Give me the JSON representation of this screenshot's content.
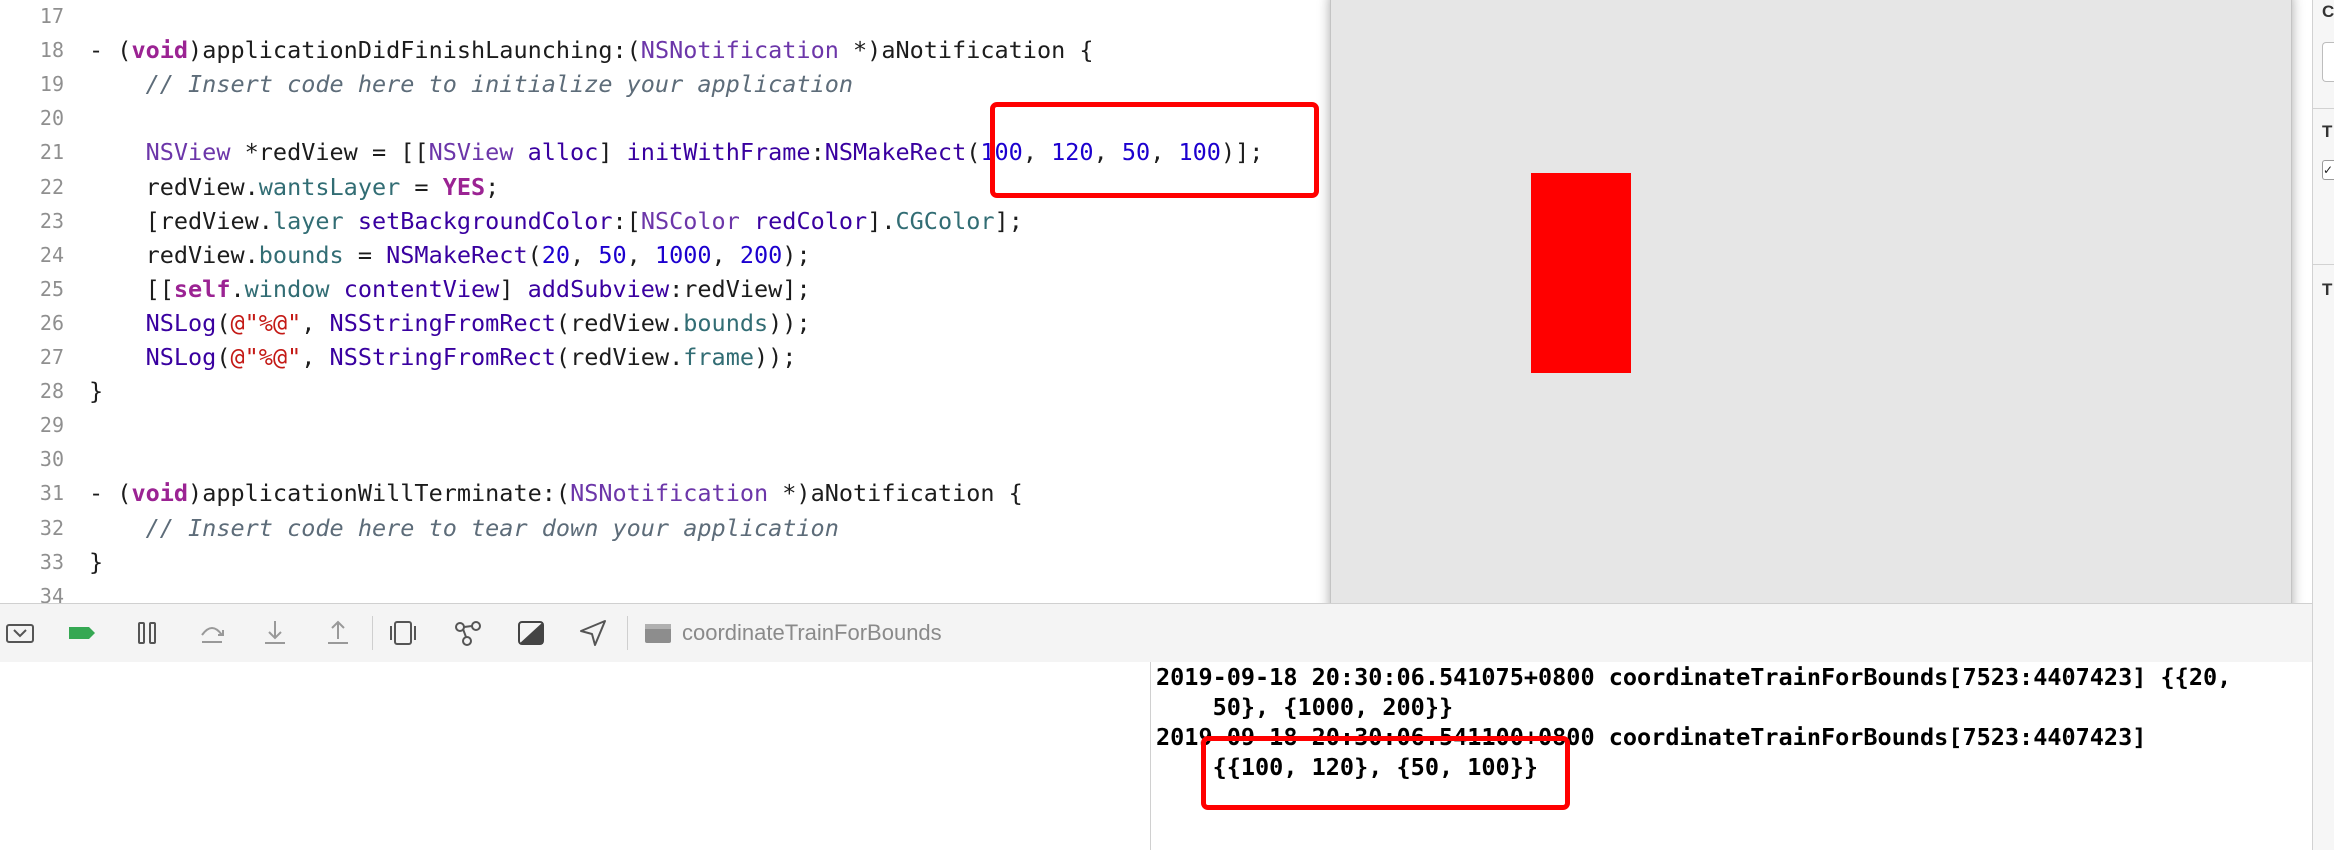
{
  "editor": {
    "lines": [
      {
        "num": "17",
        "tokens": []
      },
      {
        "num": "18",
        "tokens": [
          [
            "p",
            "- ("
          ],
          [
            "kw",
            "void"
          ],
          [
            "p",
            ")applicationDidFinishLaunching:("
          ],
          [
            "ty",
            "NSNotification"
          ],
          [
            "p",
            " *)aNotification {"
          ]
        ]
      },
      {
        "num": "19",
        "tokens": [
          [
            "p",
            "    "
          ],
          [
            "cm",
            "// Insert code here to initialize your application"
          ]
        ]
      },
      {
        "num": "20",
        "tokens": []
      },
      {
        "num": "21",
        "tokens": [
          [
            "p",
            "    "
          ],
          [
            "ty",
            "NSView"
          ],
          [
            "p",
            " *redView = [["
          ],
          [
            "ty",
            "NSView"
          ],
          [
            "p",
            " "
          ],
          [
            "fn",
            "alloc"
          ],
          [
            "p",
            "] "
          ],
          [
            "fn",
            "initWithFrame"
          ],
          [
            "p",
            ":"
          ],
          [
            "fn",
            "NSMakeRect"
          ],
          [
            "p",
            "("
          ],
          [
            "num",
            "100"
          ],
          [
            "p",
            ", "
          ],
          [
            "num",
            "120"
          ],
          [
            "p",
            ", "
          ],
          [
            "num",
            "50"
          ],
          [
            "p",
            ", "
          ],
          [
            "num",
            "100"
          ],
          [
            "p",
            ")];"
          ]
        ]
      },
      {
        "num": "22",
        "tokens": [
          [
            "p",
            "    redView."
          ],
          [
            "pr",
            "wantsLayer"
          ],
          [
            "p",
            " = "
          ],
          [
            "kw",
            "YES"
          ],
          [
            "p",
            ";"
          ]
        ]
      },
      {
        "num": "23",
        "tokens": [
          [
            "p",
            "    [redView."
          ],
          [
            "pr",
            "layer"
          ],
          [
            "p",
            " "
          ],
          [
            "fn",
            "setBackgroundColor"
          ],
          [
            "p",
            ":["
          ],
          [
            "ty",
            "NSColor"
          ],
          [
            "p",
            " "
          ],
          [
            "fn",
            "redColor"
          ],
          [
            "p",
            "]."
          ],
          [
            "pr",
            "CGColor"
          ],
          [
            "p",
            "];"
          ]
        ]
      },
      {
        "num": "24",
        "tokens": [
          [
            "p",
            "    redView."
          ],
          [
            "pr",
            "bounds"
          ],
          [
            "p",
            " = "
          ],
          [
            "fn",
            "NSMakeRect"
          ],
          [
            "p",
            "("
          ],
          [
            "num",
            "20"
          ],
          [
            "p",
            ", "
          ],
          [
            "num",
            "50"
          ],
          [
            "p",
            ", "
          ],
          [
            "num",
            "1000"
          ],
          [
            "p",
            ", "
          ],
          [
            "num",
            "200"
          ],
          [
            "p",
            ");"
          ]
        ]
      },
      {
        "num": "25",
        "tokens": [
          [
            "p",
            "    [["
          ],
          [
            "kw",
            "self"
          ],
          [
            "p",
            "."
          ],
          [
            "pr",
            "window"
          ],
          [
            "p",
            " "
          ],
          [
            "fn",
            "contentView"
          ],
          [
            "p",
            "] "
          ],
          [
            "fn",
            "addSubview"
          ],
          [
            "p",
            ":redView];"
          ]
        ]
      },
      {
        "num": "26",
        "tokens": [
          [
            "p",
            "    "
          ],
          [
            "fn",
            "NSLog"
          ],
          [
            "p",
            "("
          ],
          [
            "str",
            "@\"%@\""
          ],
          [
            "p",
            ", "
          ],
          [
            "fn",
            "NSStringFromRect"
          ],
          [
            "p",
            "(redView."
          ],
          [
            "pr",
            "bounds"
          ],
          [
            "p",
            "));"
          ]
        ]
      },
      {
        "num": "27",
        "tokens": [
          [
            "p",
            "    "
          ],
          [
            "fn",
            "NSLog"
          ],
          [
            "p",
            "("
          ],
          [
            "str",
            "@\"%@\""
          ],
          [
            "p",
            ", "
          ],
          [
            "fn",
            "NSStringFromRect"
          ],
          [
            "p",
            "(redView."
          ],
          [
            "pr",
            "frame"
          ],
          [
            "p",
            "));"
          ]
        ]
      },
      {
        "num": "28",
        "tokens": [
          [
            "p",
            "}"
          ]
        ]
      },
      {
        "num": "29",
        "tokens": []
      },
      {
        "num": "30",
        "tokens": []
      },
      {
        "num": "31",
        "tokens": [
          [
            "p",
            "- ("
          ],
          [
            "kw",
            "void"
          ],
          [
            "p",
            ")applicationWillTerminate:("
          ],
          [
            "ty",
            "NSNotification"
          ],
          [
            "p",
            " *)aNotification {"
          ]
        ]
      },
      {
        "num": "32",
        "tokens": [
          [
            "p",
            "    "
          ],
          [
            "cm",
            "// Insert code here to tear down your application"
          ]
        ]
      },
      {
        "num": "33",
        "tokens": [
          [
            "p",
            "}"
          ]
        ]
      },
      {
        "num": "34",
        "tokens": []
      }
    ]
  },
  "debug_bar": {
    "target_name": "coordinateTrainForBounds",
    "icons": [
      "hide-debug-area-icon",
      "breakpoints-toggle-icon",
      "pause-icon",
      "step-over-icon",
      "step-into-icon",
      "step-out-icon",
      "view-debugger-icon",
      "memory-graph-icon",
      "environment-overrides-icon",
      "simulate-location-icon"
    ]
  },
  "console": {
    "lines": [
      "2019-09-18 20:30:06.541075+0800 coordinateTrainForBounds[7523:4407423] {{20,",
      "    50}, {1000, 200}}",
      "2019-09-18 20:30:06.541100+0800 coordinateTrainForBounds[7523:4407423]",
      "    {{100, 120}, {50, 100}}"
    ]
  },
  "inspector": {
    "labels": [
      "C",
      "T",
      "T"
    ]
  },
  "colors": {
    "highlight": "#ff0000",
    "red_view": "#ff0000",
    "app_window": "#e6e6e6",
    "keyword": "#9b2393",
    "number": "#1c00cf",
    "string": "#c41a16",
    "comment": "#5d6c79"
  }
}
